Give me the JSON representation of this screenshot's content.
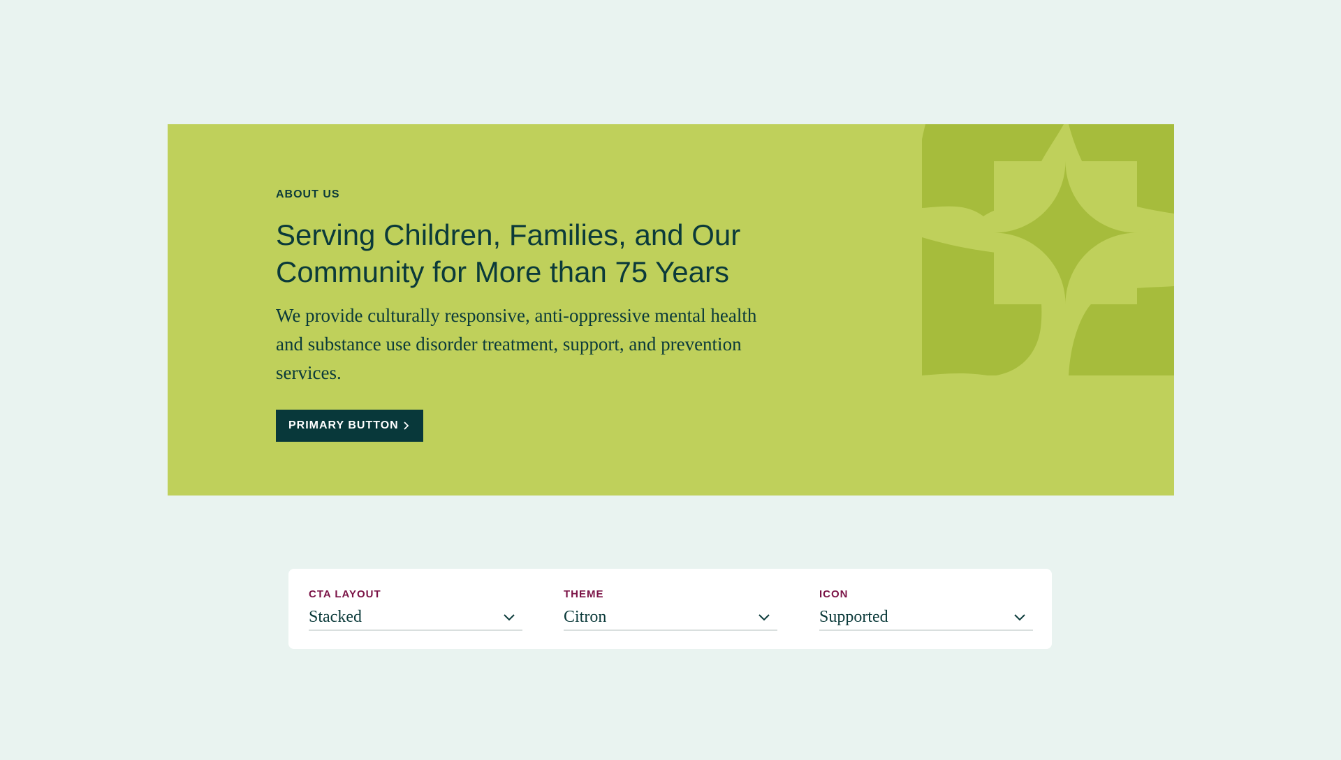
{
  "cta": {
    "eyebrow": "ABOUT US",
    "headline": "Serving Children, Families, and Our Community for More than 75 Years",
    "body": "We provide culturally responsive, anti-oppressive mental health and substance use disorder treatment, support, and prevention services.",
    "button_label": "PRIMARY BUTTON",
    "button_icon": "chevron-right-icon",
    "decoration": "quatrefoil-pattern",
    "colors": {
      "background": "#bfd05b",
      "pattern_dark": "#a6bc3c",
      "button": "#08383a",
      "text": "#0b3a3a"
    }
  },
  "controls": {
    "items": [
      {
        "label": "CTA LAYOUT",
        "value": "Stacked",
        "icon": "chevron-down-icon"
      },
      {
        "label": "THEME",
        "value": "Citron",
        "icon": "chevron-down-icon"
      },
      {
        "label": "ICON",
        "value": "Supported",
        "icon": "chevron-down-icon"
      }
    ],
    "colors": {
      "label": "#7a1245",
      "value": "#0b3a3a"
    }
  }
}
